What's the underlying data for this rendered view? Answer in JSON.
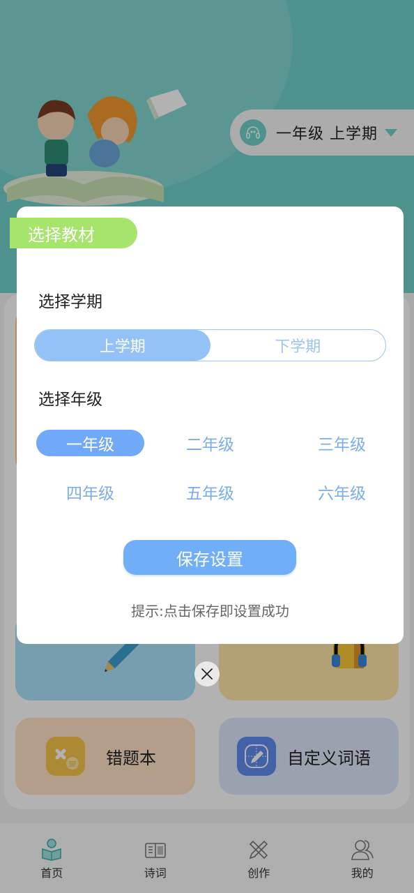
{
  "header": {
    "grade_selector": {
      "icon": "headphones-face-icon",
      "label": "一年级  上学期",
      "caret": "caret-down-icon"
    }
  },
  "features": [
    {
      "name": "write",
      "label": "",
      "icon": "pencil-icon"
    },
    {
      "name": "listen",
      "label": "",
      "icon": "headphones-book-icon"
    },
    {
      "name": "wrong-questions",
      "label": "错题本",
      "icon": "wrong-book-icon"
    },
    {
      "name": "custom-words",
      "label": "自定义词语",
      "icon": "edit-grid-icon"
    }
  ],
  "tabbar": {
    "active_index": 0,
    "items": [
      {
        "label": "首页",
        "icon": "reader-icon"
      },
      {
        "label": "诗词",
        "icon": "book-open-icon"
      },
      {
        "label": "创作",
        "icon": "ruler-pencil-icon"
      },
      {
        "label": "我的",
        "icon": "users-icon"
      }
    ]
  },
  "modal": {
    "tag": "选择教材",
    "term_title": "选择学期",
    "terms": [
      {
        "label": "上学期",
        "selected": true
      },
      {
        "label": "下学期",
        "selected": false
      }
    ],
    "grade_title": "选择年级",
    "grades": [
      {
        "label": "一年级",
        "selected": true
      },
      {
        "label": "二年级",
        "selected": false
      },
      {
        "label": "三年级",
        "selected": false
      },
      {
        "label": "四年级",
        "selected": false
      },
      {
        "label": "五年级",
        "selected": false
      },
      {
        "label": "六年级",
        "selected": false
      }
    ],
    "save_label": "保存设置",
    "hint": "提示:点击保存即设置成功",
    "close_icon": "close-icon"
  },
  "colors": {
    "teal": "#6fd1cb",
    "tag_green": "#a7e46c",
    "accent_blue": "#6fa9f7",
    "term_active_blue": "#94c1f6",
    "grade_text_blue": "#7aaeea",
    "save_blue": "#70aff8"
  }
}
